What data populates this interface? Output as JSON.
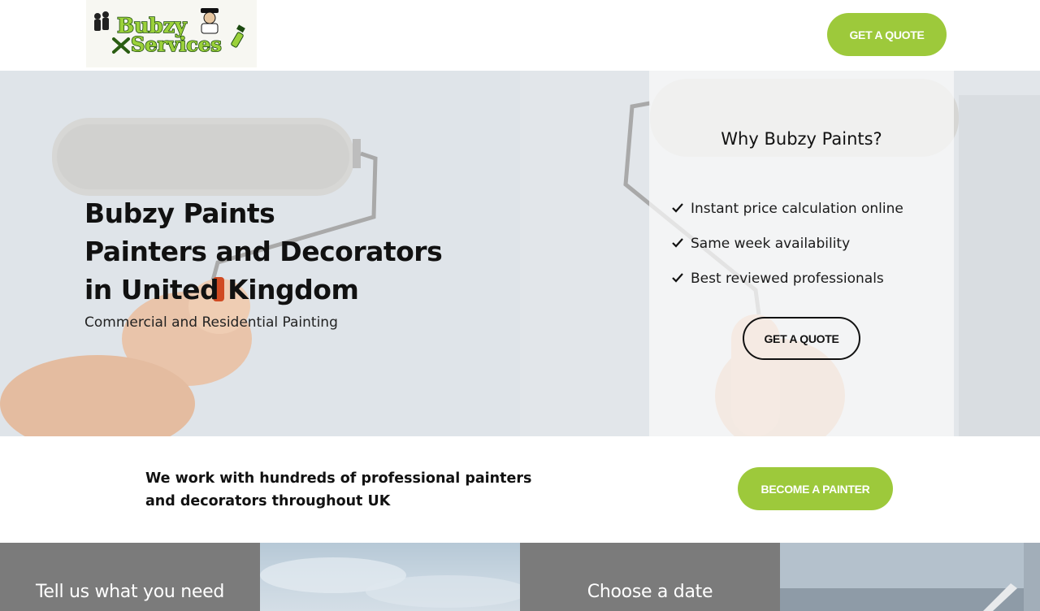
{
  "header": {
    "logo_line1": "Bubzy",
    "logo_line2": "Services",
    "quote_button": "GET A QUOTE"
  },
  "hero": {
    "title_lines": [
      "Bubzy Paints",
      "Painters and Decorators",
      "in United Kingdom"
    ],
    "subtitle": "Commercial and Residential Painting"
  },
  "why": {
    "title": "Why Bubzy Paints?",
    "items": [
      "Instant price calculation online",
      "Same week availability",
      "Best reviewed professionals"
    ],
    "quote_button": "GET A QUOTE"
  },
  "band": {
    "text_line1": "We work with hundreds of professional painters",
    "text_line2": "and decorators throughout UK",
    "button": "BECOME A PAINTER"
  },
  "steps": [
    {
      "title": "Tell us what you need"
    },
    {
      "title": ""
    },
    {
      "title": "Choose a date"
    },
    {
      "title": ""
    }
  ],
  "colors": {
    "accent_green": "#9dc93b",
    "step_gray": "#7b7b7b",
    "text_dark": "#111111"
  },
  "icons": {
    "checkmark": "check-icon",
    "logo": "bubzy-services-logo"
  }
}
